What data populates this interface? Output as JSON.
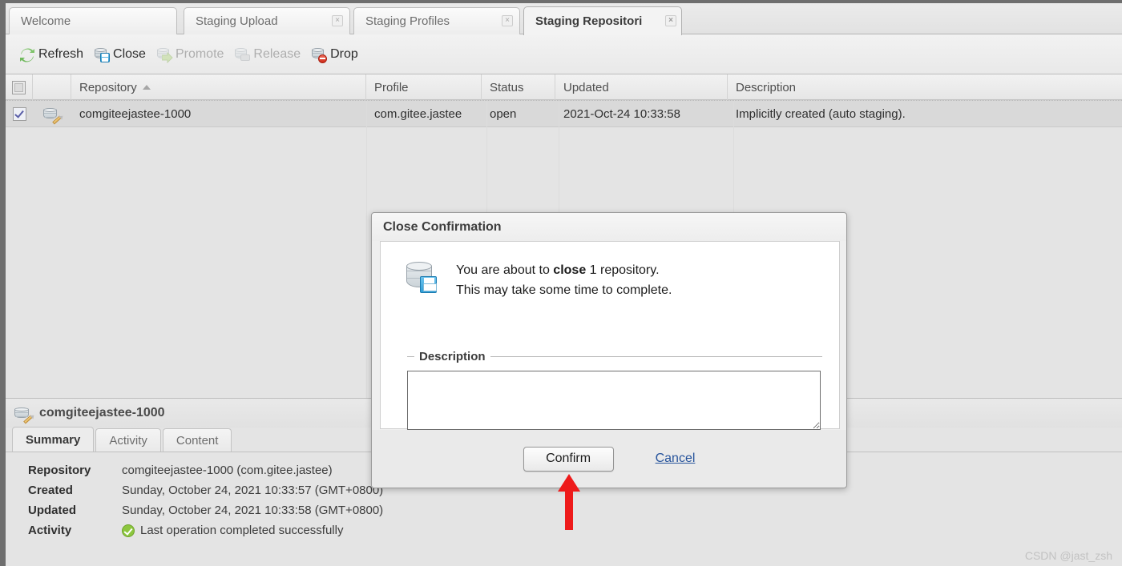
{
  "window": {
    "tabs": [
      {
        "label": "Welcome",
        "closable": false,
        "active": false
      },
      {
        "label": "Staging Upload",
        "closable": true,
        "active": false
      },
      {
        "label": "Staging Profiles",
        "closable": true,
        "active": false
      },
      {
        "label": "Staging Repositori",
        "closable": true,
        "active": true
      }
    ],
    "close_glyph": "×"
  },
  "toolbar": {
    "buttons": [
      {
        "label": "Refresh",
        "icon": "refresh-icon",
        "enabled": true
      },
      {
        "label": "Close",
        "icon": "repository-close-icon",
        "enabled": true
      },
      {
        "label": "Promote",
        "icon": "repository-promote-icon",
        "enabled": false
      },
      {
        "label": "Release",
        "icon": "repository-release-icon",
        "enabled": false
      },
      {
        "label": "Drop",
        "icon": "repository-drop-icon",
        "enabled": true
      }
    ]
  },
  "table": {
    "columns": [
      "Repository",
      "Profile",
      "Status",
      "Updated",
      "Description"
    ],
    "sort": {
      "column": "Repository",
      "direction": "asc"
    },
    "header_checkbox_checked": false,
    "rows": [
      {
        "checked": true,
        "icon": "repository-icon",
        "repository": "comgiteejastee-1000",
        "profile": "com.gitee.jastee",
        "status": "open",
        "updated": "2021-Oct-24 10:33:58",
        "description": "Implicitly created (auto staging)."
      }
    ]
  },
  "detail": {
    "title": "comgiteejastee-1000",
    "tabs": [
      {
        "label": "Summary",
        "active": true
      },
      {
        "label": "Activity",
        "active": false
      },
      {
        "label": "Content",
        "active": false
      }
    ],
    "fields": [
      {
        "key": "Repository",
        "value": "comgiteejastee-1000 (com.gitee.jastee)"
      },
      {
        "key": "Created",
        "value": "Sunday, October 24, 2021 10:33:57 (GMT+0800)"
      },
      {
        "key": "Updated",
        "value": "Sunday, October 24, 2021 10:33:58 (GMT+0800)"
      },
      {
        "key": "Activity",
        "value": "Last operation completed successfully",
        "status_icon": "success-check-icon"
      }
    ]
  },
  "dialog": {
    "title": "Close Confirmation",
    "icon": "database-save-icon",
    "message_line1_pre": "You are about to ",
    "message_line1_bold": "close",
    "message_line1_post": " 1 repository.",
    "message_line2": "This may take some time to complete.",
    "description_legend": "Description",
    "description_value": "",
    "description_placeholder": "",
    "confirm_label": "Confirm",
    "cancel_label": "Cancel"
  },
  "annotation": {
    "arrow_color": "#ee1b1b",
    "points_at": "Confirm"
  },
  "watermark": "CSDN @jast_zsh",
  "colors": {
    "accent_link": "#27549c",
    "panel_bg": "#e4e4e4",
    "frame": "#6e6e6e",
    "selected_row": "#d9d9d9"
  }
}
